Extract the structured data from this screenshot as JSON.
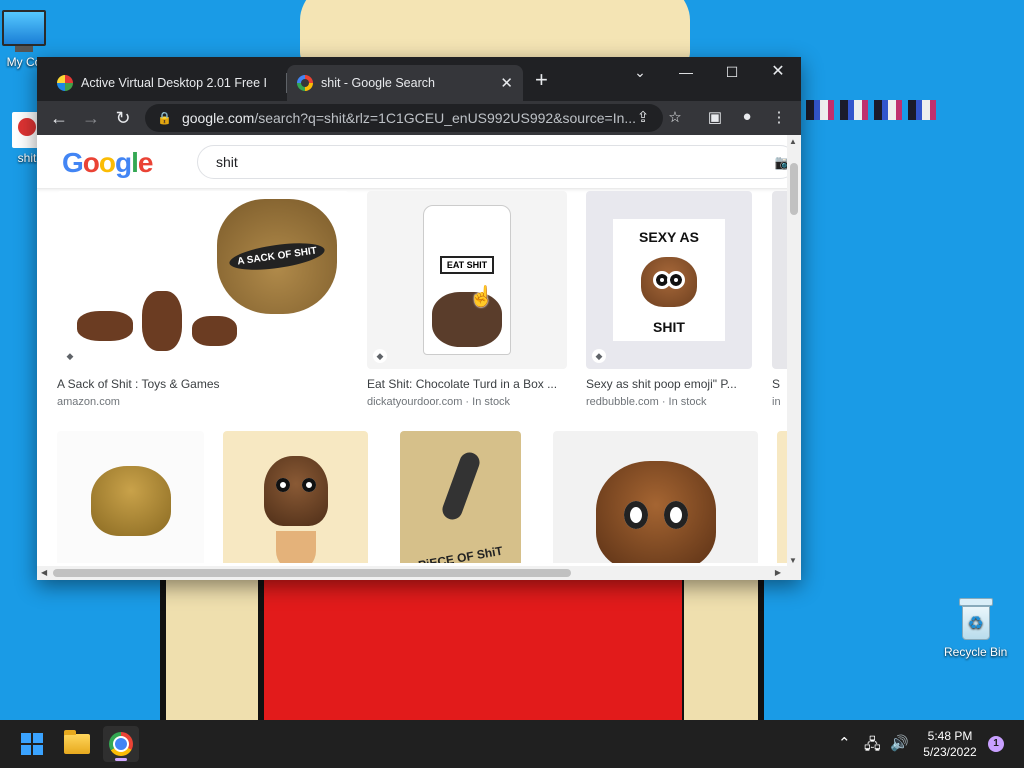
{
  "desktop": {
    "icons": [
      {
        "label": "My Co",
        "icon": "computer-icon"
      },
      {
        "label": "shit",
        "icon": "file-icon"
      },
      {
        "label": "Recycle Bin",
        "icon": "recycle-bin-icon"
      }
    ]
  },
  "browser": {
    "tabs": [
      {
        "title": "Active Virtual Desktop 2.01 Free I",
        "favicon": "avd-favicon-icon",
        "active": false
      },
      {
        "title": "shit - Google Search",
        "favicon": "google-favicon-icon",
        "active": true
      }
    ],
    "close_glyph": "✕",
    "new_tab_glyph": "+",
    "window_controls": {
      "tab_search": "⌄",
      "minimize": "—",
      "maximize": "☐",
      "close": "✕"
    },
    "toolbar": {
      "back": "←",
      "forward": "→",
      "reload": "↻"
    },
    "address": {
      "host": "google.com",
      "path": "/search?q=shit&rlz=1C1GCEU_enUS992US992&source=In..."
    }
  },
  "google": {
    "logo_letters": [
      "G",
      "o",
      "o",
      "g",
      "l",
      "e"
    ],
    "search_query": "shit",
    "results_row1": [
      {
        "title": "A Sack of Shit : Toys & Games",
        "source": "amazon.com",
        "image_label": "A SACK OF SHIT"
      },
      {
        "title": "Eat Shit: Chocolate Turd in a Box ...",
        "source": "dickatyourdoor.com · In stock",
        "image_label": "EAT SHIT"
      },
      {
        "title": "Sexy as shit poop emoji\" P...",
        "source": "redbubble.com · In stock",
        "image_label_top": "SEXY AS",
        "image_label_bottom": "SHIT"
      },
      {
        "title": "S",
        "source": "in"
      }
    ],
    "results_row2": [
      {
        "image": "gold-poop"
      },
      {
        "image": "ice-cream-poop"
      },
      {
        "image": "sand-poop",
        "image_label": "PiECE OF ShiT"
      },
      {
        "image": "emoji-poop"
      }
    ]
  },
  "taskbar": {
    "time": "5:48 PM",
    "date": "5/23/2022",
    "notification_count": "1"
  },
  "colors": {
    "desktop_bg": "#1a9be6",
    "chrome_dark": "#202124",
    "chrome_tab_active": "#35363a"
  }
}
